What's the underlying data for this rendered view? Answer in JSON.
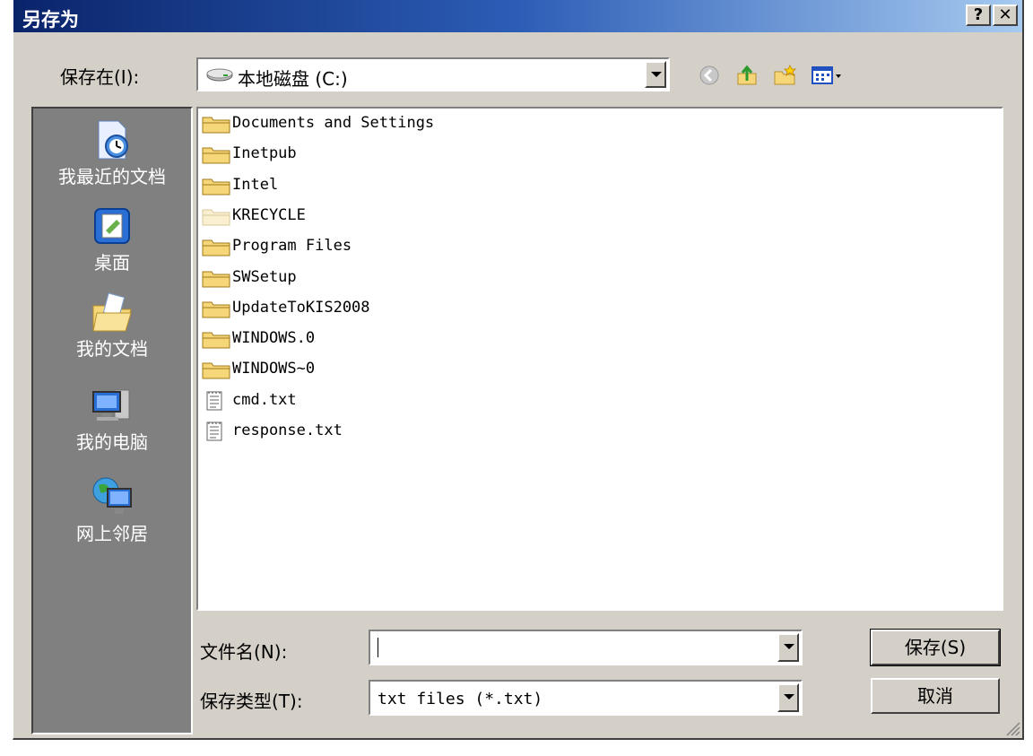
{
  "window": {
    "title": "另存为",
    "help_label": "?",
    "close_label": "✕"
  },
  "save_in": {
    "label": "保存在(I):",
    "value": "本地磁盘 (C:)",
    "drive_icon": "hard-drive-icon"
  },
  "toolbar": {
    "back_icon": "back-icon",
    "up_icon": "up-folder-icon",
    "new_folder_icon": "new-folder-icon",
    "views_icon": "views-menu-icon"
  },
  "places": [
    {
      "label": "我最近的文档",
      "icon": "recent-documents-icon"
    },
    {
      "label": "桌面",
      "icon": "desktop-icon"
    },
    {
      "label": "我的文档",
      "icon": "my-documents-icon"
    },
    {
      "label": "我的电脑",
      "icon": "my-computer-icon"
    },
    {
      "label": "网上邻居",
      "icon": "network-places-icon"
    }
  ],
  "files": [
    {
      "name": "Documents and Settings",
      "type": "folder"
    },
    {
      "name": "Inetpub",
      "type": "folder"
    },
    {
      "name": "Intel",
      "type": "folder"
    },
    {
      "name": "KRECYCLE",
      "type": "folder-hidden"
    },
    {
      "name": "Program Files",
      "type": "folder"
    },
    {
      "name": "SWSetup",
      "type": "folder"
    },
    {
      "name": "UpdateToKIS2008",
      "type": "folder"
    },
    {
      "name": "WINDOWS.0",
      "type": "folder"
    },
    {
      "name": "WINDOWS~0",
      "type": "folder"
    },
    {
      "name": "cmd.txt",
      "type": "text-file"
    },
    {
      "name": "response.txt",
      "type": "text-file"
    }
  ],
  "filename": {
    "label": "文件名(N):",
    "value": ""
  },
  "filetype": {
    "label": "保存类型(T):",
    "value": "txt files (*.txt)"
  },
  "buttons": {
    "save": "保存(S)",
    "cancel": "取消"
  },
  "colors": {
    "titlebar_start": "#0a246a",
    "titlebar_end": "#a6caf0",
    "face": "#d4d0c8",
    "places_bg": "#808080",
    "folder": "#f5d77a"
  }
}
